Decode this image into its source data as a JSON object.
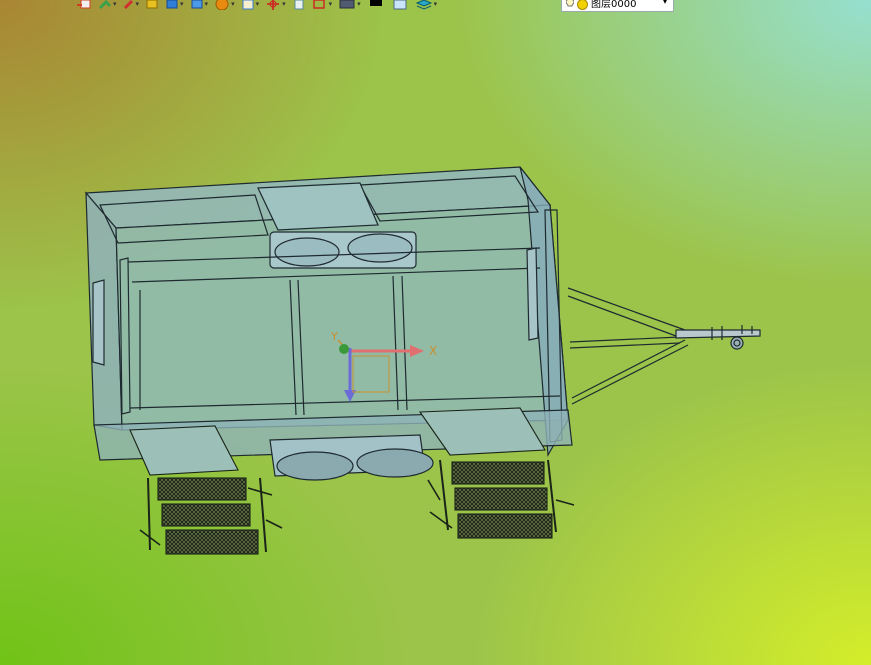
{
  "toolbar": {
    "items": [
      {
        "icon": "export-icon",
        "color": "#d04020"
      },
      {
        "icon": "tools-icon",
        "color": "#3aa04a"
      },
      {
        "icon": "pencil-icon",
        "color": "#d03030"
      },
      {
        "icon": "yellow-cube-icon",
        "color": "#e8c020"
      },
      {
        "icon": "blue-cube-icon",
        "color": "#2f7fd8"
      },
      {
        "icon": "blue-box-icon",
        "color": "#2f7fd8"
      },
      {
        "icon": "orange-wheel-icon",
        "color": "#e88a10"
      },
      {
        "icon": "clipboard-icon",
        "color": "#3d7ccf"
      },
      {
        "icon": "crosshair-icon",
        "color": "#d02020"
      },
      {
        "icon": "document-icon",
        "color": "#5a8a9a"
      },
      {
        "icon": "frame-icon",
        "color": "#d02020"
      },
      {
        "icon": "monitor-icon",
        "color": "#505a70"
      },
      {
        "icon": "black-square-icon",
        "color": "#000000"
      },
      {
        "icon": "light-blue-square-icon",
        "color": "#c8e6f7"
      },
      {
        "icon": "layers-icon",
        "color": "#2aa8c8"
      }
    ],
    "layer_selector": {
      "value": "图层0000"
    }
  },
  "viewport": {
    "axis": {
      "x_label": "X",
      "y_label": "Y"
    },
    "colors": {
      "model_fill": "#8fb8c4",
      "model_line": "#1e2a30",
      "x_axis": "#e07070",
      "y_axis": "#6c6cd8",
      "origin": "#3a9a3a"
    }
  }
}
